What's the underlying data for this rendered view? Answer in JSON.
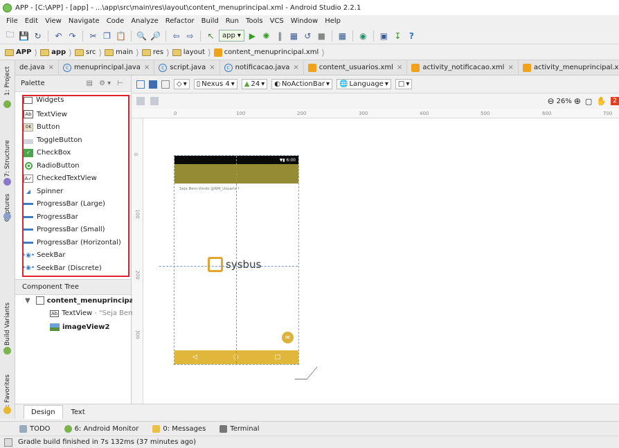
{
  "title": "APP - [C:\\APP] - [app] - ...\\app\\src\\main\\res\\layout\\content_menuprincipal.xml - Android Studio 2.2.1",
  "menu": [
    "File",
    "Edit",
    "View",
    "Navigate",
    "Code",
    "Analyze",
    "Refactor",
    "Build",
    "Run",
    "Tools",
    "VCS",
    "Window",
    "Help"
  ],
  "run_config": "app",
  "breadcrumbs": [
    "APP",
    "app",
    "src",
    "main",
    "res",
    "layout",
    "content_menuprincipal.xml"
  ],
  "left_tabs": [
    "1: Project",
    "7: Structure",
    "Captures",
    "Build Variants",
    "2: Favorites"
  ],
  "editor_tabs": [
    {
      "label": "de.java",
      "kind": "none"
    },
    {
      "label": "menuprincipal.java",
      "kind": "class"
    },
    {
      "label": "script.java",
      "kind": "class"
    },
    {
      "label": "notificacao.java",
      "kind": "class"
    },
    {
      "label": "content_usuarios.xml",
      "kind": "xml"
    },
    {
      "label": "activity_notificacao.xml",
      "kind": "xml"
    },
    {
      "label": "activity_menuprincipal.xml",
      "kind": "xml"
    }
  ],
  "palette": {
    "title": "Palette",
    "group": "Widgets",
    "items": [
      "TextView",
      "Button",
      "ToggleButton",
      "CheckBox",
      "RadioButton",
      "CheckedTextView",
      "Spinner",
      "ProgressBar (Large)",
      "ProgressBar",
      "ProgressBar (Small)",
      "ProgressBar (Horizontal)",
      "SeekBar",
      "SeekBar (Discrete)"
    ]
  },
  "component_tree": {
    "title": "Component Tree",
    "root": "content_menuprincipal",
    "children": [
      {
        "name": "TextView",
        "detail": "- \"Seja Bem"
      },
      {
        "name": "imageView2",
        "detail": ""
      }
    ]
  },
  "designer_toolbar": {
    "device": "Nexus 4",
    "api": "24",
    "theme": "NoActionBar",
    "language": "Language"
  },
  "zoom": "26%",
  "ruler_h": [
    "0",
    "100",
    "200",
    "300",
    "400",
    "500",
    "600",
    "700"
  ],
  "ruler_v": [
    "0",
    "100",
    "200",
    "300"
  ],
  "device": {
    "time": "6:00",
    "text": "Seja Bem-Vindo @NM_Usuario !",
    "logo_text": "sysbus"
  },
  "design_tabs": [
    "Design",
    "Text"
  ],
  "tool_windows": [
    "TODO",
    "6: Android Monitor",
    "0: Messages",
    "Terminal"
  ],
  "status": "Gradle build finished in 7s 132ms (37 minutes ago)",
  "colors": {
    "highlight": "#e0202a",
    "appbar": "#958b34",
    "navbar": "#e0b73a"
  }
}
